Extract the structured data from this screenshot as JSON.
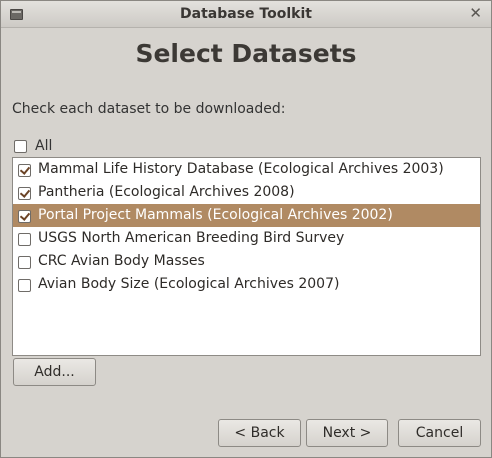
{
  "window": {
    "title": "Database Toolkit",
    "close_glyph": "✕"
  },
  "page": {
    "heading": "Select Datasets",
    "instructions": "Check each dataset to be downloaded:",
    "all_label": "All",
    "all_checked": false
  },
  "datasets": [
    {
      "label": "Mammal Life History Database (Ecological Archives 2003)",
      "checked": true,
      "selected": false
    },
    {
      "label": "Pantheria (Ecological Archives 2008)",
      "checked": true,
      "selected": false
    },
    {
      "label": "Portal Project Mammals (Ecological Archives 2002)",
      "checked": true,
      "selected": true
    },
    {
      "label": "USGS North American Breeding Bird Survey",
      "checked": false,
      "selected": false
    },
    {
      "label": "CRC Avian Body Masses",
      "checked": false,
      "selected": false
    },
    {
      "label": "Avian Body Size (Ecological Archives 2007)",
      "checked": false,
      "selected": false
    }
  ],
  "buttons": {
    "add": "Add...",
    "back": "< Back",
    "next": "Next >",
    "cancel": "Cancel"
  },
  "colors": {
    "selection": "#b08a63",
    "window_bg": "#d6d3ce"
  }
}
